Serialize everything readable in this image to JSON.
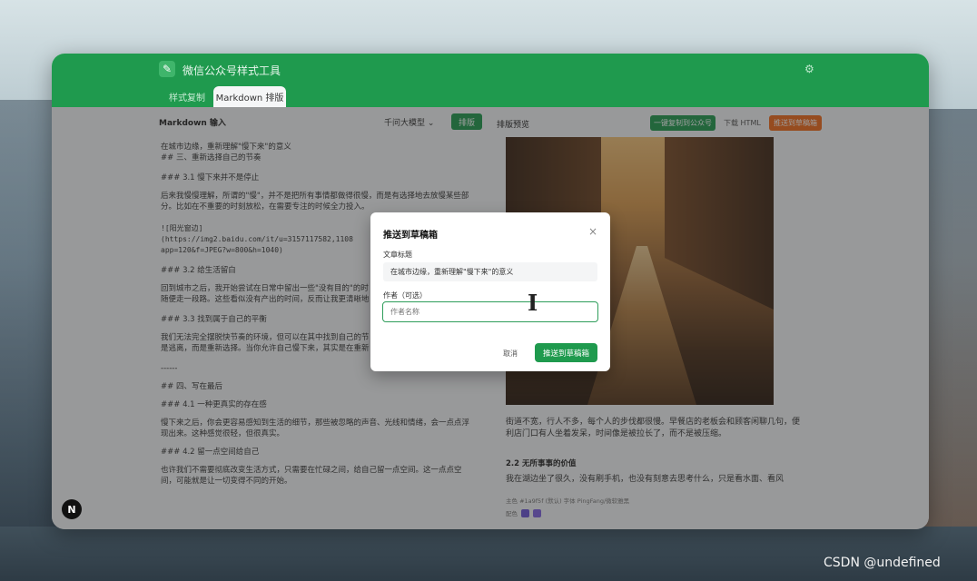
{
  "app": {
    "title": "微信公众号样式工具",
    "tabs": [
      {
        "label": "样式复制"
      },
      {
        "label": "Markdown 排版"
      }
    ]
  },
  "editor": {
    "label": "Markdown 输入",
    "model_select": "千问大模型 ⌄",
    "format_button": "排版",
    "lines": [
      "在城市边缘，重新理解\"慢下来\"的意义",
      "## 三、重新选择自己的节奏",
      "### 3.1 慢下来并不是停止",
      "后来我慢慢理解，所谓的\"慢\"，并不是把所有事情都做得很慢，而是有选择地去放慢某些部",
      "分。比如在不重要的时刻放松，在需要专注的时候全力投入。",
      "",
      "![阳光窗边]",
      "(https://img2.baidu.com/it/u=3157117582,1108",
      "app=120&f=JPEG?w=800&h=1040)",
      "### 3.2 给生活留白",
      "回到城市之后，我开始尝试在日常中留出一些\"没有目的\"的时",
      "随便走一段路。这些看似没有产出的时间，反而让我更清晰地",
      "### 3.3 找到属于自己的平衡",
      "我们无法完全摆脱快节奏的环境，但可以在其中找到自己的节",
      "是逃离，而是重新选择。当你允许自己慢下来，其实是在重新",
      "------",
      "## 四、写在最后",
      "### 4.1 一种更真实的存在感",
      "慢下来之后，你会更容易感知到生活的细节，那些被忽略的声音、光线和情绪，会一点点浮",
      "现出来。这种感觉很轻，但很真实。",
      "### 4.2 留一点空间给自己",
      "也许我们不需要彻底改变生活方式，只需要在忙碌之间，给自己留一点空间。这一点点空",
      "间，可能就是让一切变得不同的开始。"
    ]
  },
  "preview": {
    "label": "排版预览",
    "copy_button": "一键复制到公众号",
    "download_link": "下载 HTML",
    "push_button": "推送到草稿箱",
    "text1": "街道不宽，行人不多，每个人的步伐都很慢。早餐店的老板会和顾客闲聊几句，便利店门口有人坐着发呆，时间像是被拉长了，而不是被压缩。",
    "heading": "2.2 无所事事的价值",
    "text2": "我在湖边坐了很久，没有刷手机，也没有刻意去思考什么，只是看水面、看风",
    "meta1": "主色  #1a9f5f  (默认)        字体  PingFang/微软雅黑",
    "meta2_label": "配色",
    "swatch_colors": [
      "#6b55d6",
      "#7e63e0"
    ]
  },
  "modal": {
    "title": "推送到草稿箱",
    "close": "×",
    "title_label": "文章标题",
    "title_value": "在城市边缘，重新理解\"慢下来\"的意义",
    "author_label": "作者（可选）",
    "author_placeholder": "作者名称",
    "cancel": "取消",
    "confirm": "推送到草稿箱"
  },
  "badge": "N",
  "watermark": "CSDN @undefined",
  "colors": {
    "brand": "#1f9a4e",
    "accent_orange": "#f06a1a"
  }
}
